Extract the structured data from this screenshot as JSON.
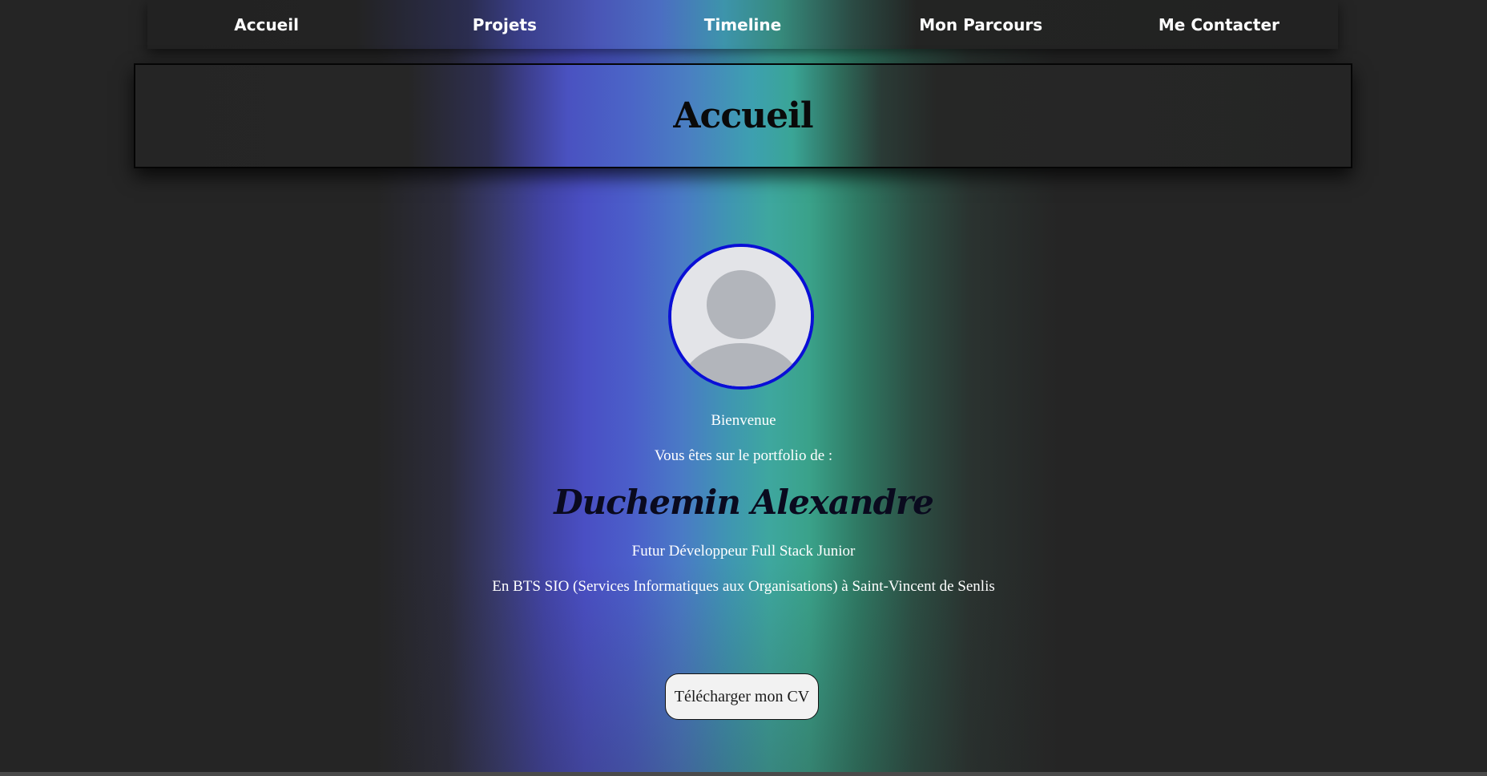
{
  "nav": {
    "items": [
      {
        "label": "Accueil"
      },
      {
        "label": "Projets"
      },
      {
        "label": "Timeline"
      },
      {
        "label": "Mon Parcours"
      },
      {
        "label": "Me Contacter"
      }
    ]
  },
  "banner": {
    "title": "Accueil"
  },
  "hero": {
    "avatar_icon": "user-silhouette-icon",
    "welcome": "Bienvenue",
    "intro": "Vous êtes sur le portfolio de :",
    "name": "Duchemin Alexandre",
    "role": "Futur Développeur Full Stack Junior",
    "school": "En BTS SIO (Services Informatiques aux Organisations) à Saint-Vincent de Senlis",
    "cv_button_label": "Télécharger mon CV"
  },
  "colors": {
    "background": "#252525",
    "avatar_border": "#0a0fd6",
    "aurora_blue": "#4a4fc4",
    "aurora_teal": "#3ea79f"
  }
}
